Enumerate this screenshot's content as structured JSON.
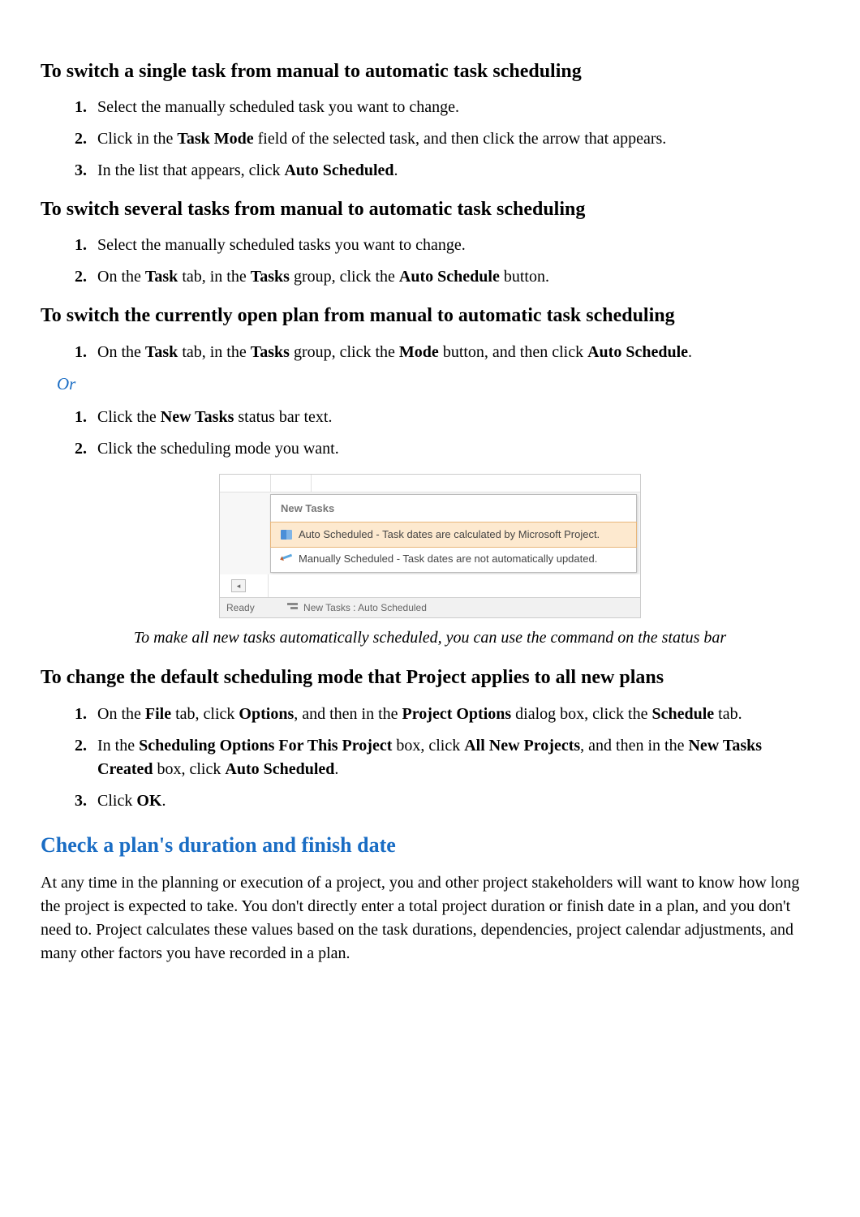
{
  "sections": [
    {
      "heading": "To switch a single task from manual to automatic task scheduling",
      "steps": [
        {
          "num": "1.",
          "text": "Select the manually scheduled task you want to change."
        },
        {
          "num": "2.",
          "html": "Click in the <strong>Task Mode</strong> field of the selected task, and then click the arrow that appears."
        },
        {
          "num": "3.",
          "html": "In the list that appears, click <strong>Auto Scheduled</strong>."
        }
      ]
    },
    {
      "heading": "To switch several tasks from manual to automatic task scheduling",
      "steps": [
        {
          "num": "1.",
          "text": "Select the manually scheduled tasks you want to change."
        },
        {
          "num": "2.",
          "html": "On the <strong>Task</strong> tab, in the <strong>Tasks</strong> group, click the <strong>Auto Schedule</strong> button."
        }
      ]
    },
    {
      "heading": "To switch the currently open plan from manual to automatic task scheduling",
      "steps": [
        {
          "num": "1.",
          "html": "On the <strong>Task</strong> tab, in the <strong>Tasks</strong> group, click the <strong>Mode</strong> button, and then click <strong>Auto Schedule</strong>."
        }
      ],
      "or": "Or",
      "steps2": [
        {
          "num": "1.",
          "html": "Click the <strong>New Tasks</strong> status bar text."
        },
        {
          "num": "2.",
          "text": "Click the scheduling mode you want."
        }
      ]
    }
  ],
  "figure": {
    "menu_header": "New Tasks",
    "item_auto": "Auto Scheduled - Task dates are calculated by Microsoft Project.",
    "item_manual": "Manually Scheduled - Task dates are not automatically updated.",
    "scroll_glyph": "◂",
    "status_ready": "Ready",
    "status_tasks": "New Tasks : Auto Scheduled",
    "caption": "To make all new tasks automatically scheduled, you can use the command on the status bar"
  },
  "section_default": {
    "heading": "To change the default scheduling mode that Project applies to all new plans",
    "steps": [
      {
        "num": "1.",
        "html": "On the <strong>File</strong> tab, click <strong>Options</strong>, and then in the <strong>Project Options</strong> dialog box, click the <strong>Schedule</strong> tab."
      },
      {
        "num": "2.",
        "html": "In the <strong>Scheduling Options For This Project</strong> box, click <strong>All New Projects</strong>, and then in the <strong>New Tasks Created</strong> box, click <strong>Auto Scheduled</strong>."
      },
      {
        "num": "3.",
        "html": "Click <strong>OK</strong>."
      }
    ]
  },
  "check_section": {
    "title": "Check a plan's duration and finish date",
    "body": "At any time in the planning or execution of a project, you and other project stakeholders will want to know how long the project is expected to take. You don't directly enter a total project duration or finish date in a plan, and you don't need to. Project calculates these values based on the task durations, dependencies, project calendar adjustments, and many other factors you have recorded in a plan."
  }
}
